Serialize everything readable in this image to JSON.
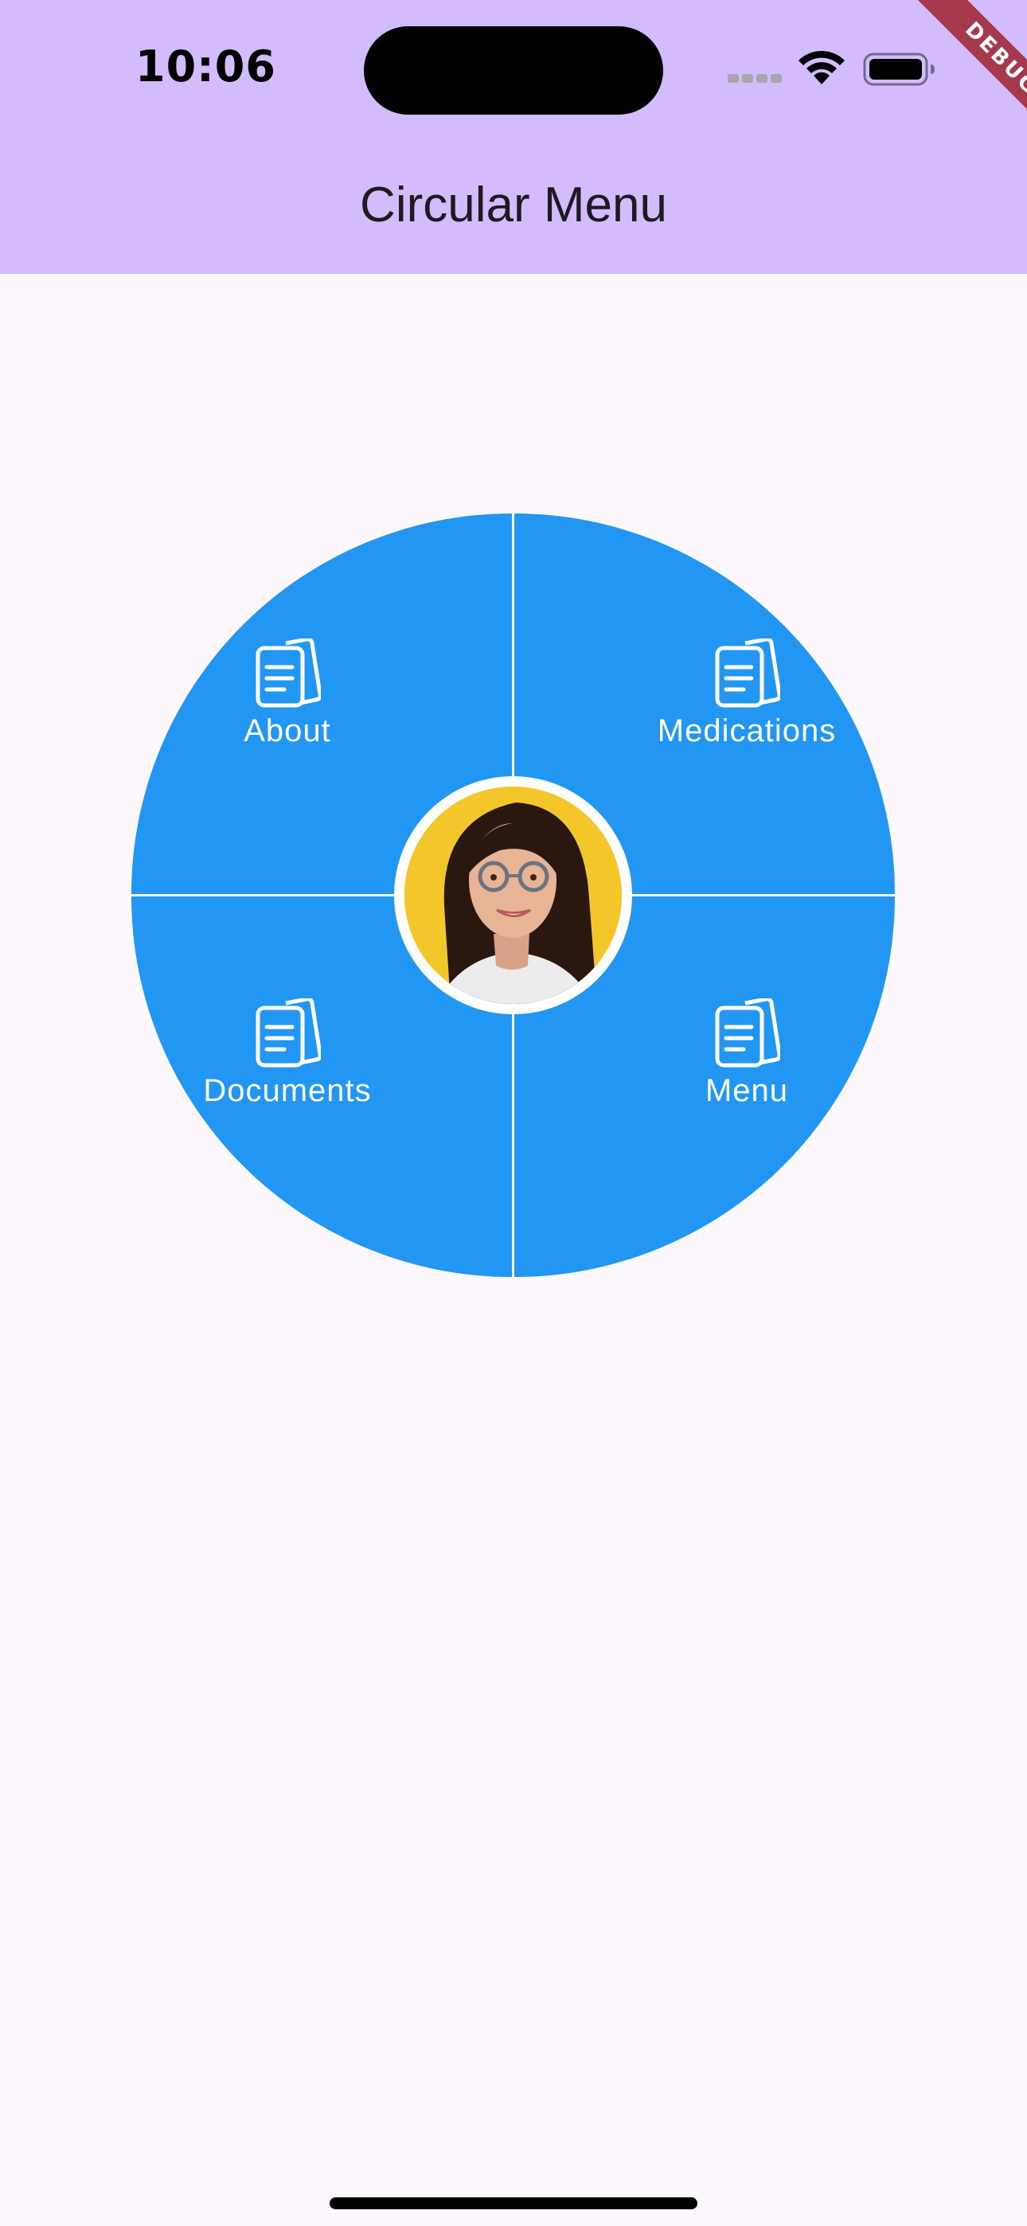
{
  "status_bar": {
    "time": "10:06"
  },
  "debug_banner": {
    "label": "DEBUG"
  },
  "app_bar": {
    "title": "Circular Menu",
    "background": "#d3bcfd"
  },
  "circular_menu": {
    "color": "#2196f3",
    "segments": [
      {
        "label": "About",
        "icon": "document-icon"
      },
      {
        "label": "Medications",
        "icon": "document-icon"
      },
      {
        "label": "Documents",
        "icon": "document-icon"
      },
      {
        "label": "Menu",
        "icon": "document-icon"
      }
    ],
    "center": {
      "icon": "profile-avatar",
      "background": "#f3c72a"
    }
  }
}
